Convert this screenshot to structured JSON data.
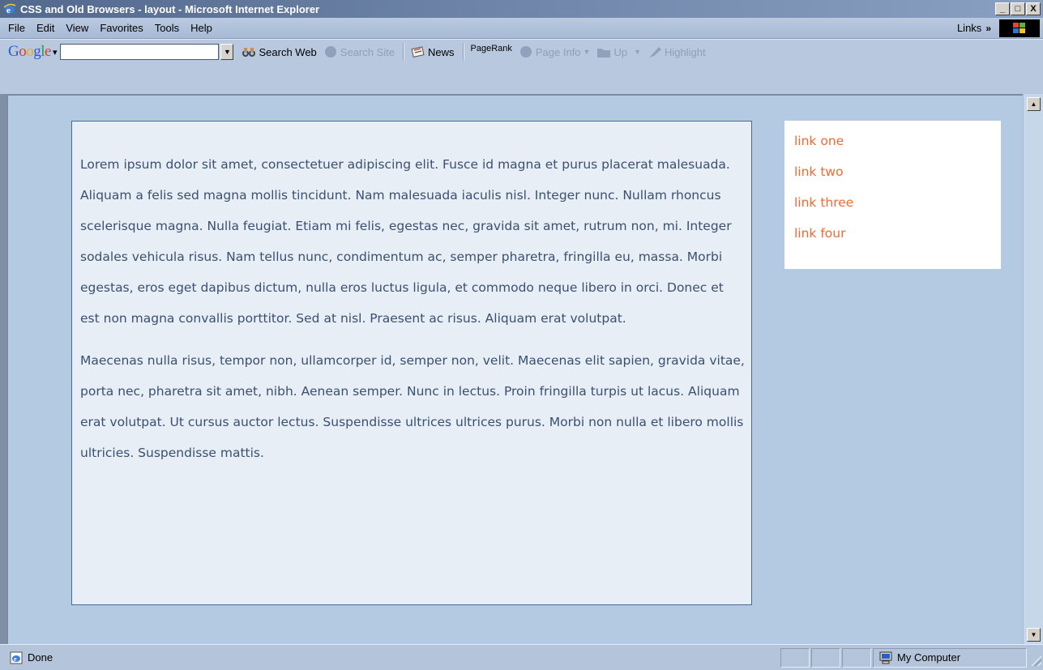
{
  "window": {
    "title": "CSS and Old Browsers - layout - Microsoft Internet Explorer",
    "minimize_glyph": "_",
    "maximize_glyph": "□",
    "close_glyph": "X"
  },
  "menu": {
    "items": [
      "File",
      "Edit",
      "View",
      "Favorites",
      "Tools",
      "Help"
    ],
    "links_label": "Links",
    "links_chevron": "»"
  },
  "google_toolbar": {
    "logo": "Google",
    "search_value": "",
    "search_web": "Search Web",
    "search_site": "Search Site",
    "news": "News",
    "pagerank": "PageRank",
    "page_info": "Page Info",
    "up": "Up",
    "highlight": "Highlight"
  },
  "content": {
    "paragraphs": [
      "Lorem ipsum dolor sit amet, consectetuer adipiscing elit. Fusce id magna et purus placerat malesuada. Aliquam a felis sed magna mollis tincidunt. Nam malesuada iaculis nisl. Integer nunc. Nullam rhoncus scelerisque magna. Nulla feugiat. Etiam mi felis, egestas nec, gravida sit amet, rutrum non, mi. Integer sodales vehicula risus. Nam tellus nunc, condimentum ac, semper pharetra, fringilla eu, massa. Morbi egestas, eros eget dapibus dictum, nulla eros luctus ligula, et commodo neque libero in orci. Donec et est non magna convallis porttitor. Sed at nisl. Praesent ac risus. Aliquam erat volutpat.",
      "Maecenas nulla risus, tempor non, ullamcorper id, semper non, velit. Maecenas elit sapien, gravida vitae, porta nec, pharetra sit amet, nibh. Aenean semper. Nunc in lectus. Proin fringilla turpis ut lacus. Aliquam erat volutpat. Ut cursus auctor lectus. Suspendisse ultrices ultrices purus. Morbi non nulla et libero mollis ultricies. Suspendisse mattis."
    ],
    "links": [
      "link one",
      "link two",
      "link three",
      "link four"
    ]
  },
  "status": {
    "text": "Done",
    "zone": "My Computer"
  },
  "colors": {
    "title_bar": "#52698d",
    "page_background": "#b4c9e2",
    "content_box": "#e8eef6",
    "body_text": "#3a5070",
    "link": "#ef6a33"
  }
}
